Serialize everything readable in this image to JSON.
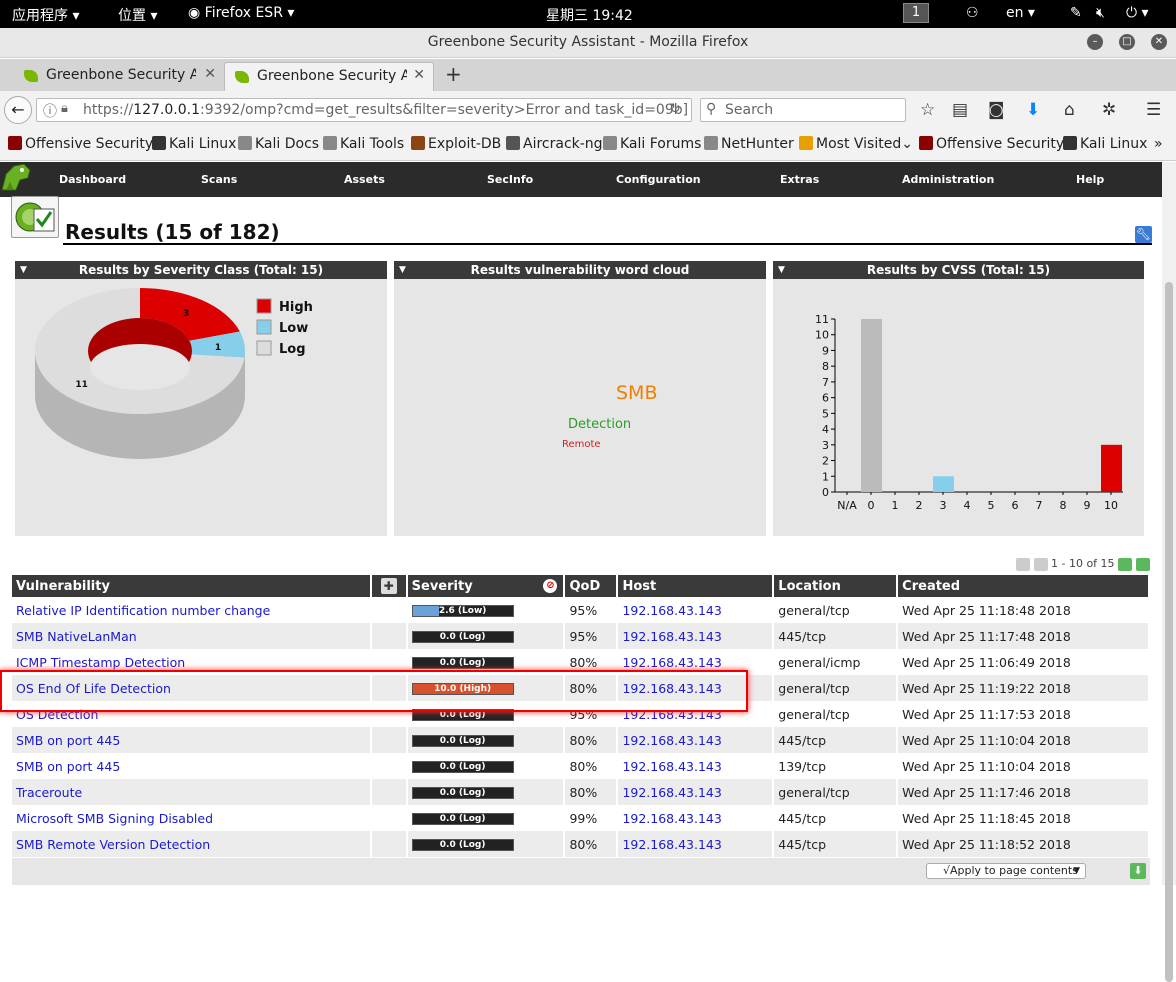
{
  "sysbar": {
    "apps": "应用程序 ▾",
    "places": "位置 ▾",
    "browser": "Firefox ESR ▾",
    "clock": "星期三 19:42",
    "workspace": "1",
    "lang": "en ▾"
  },
  "window": {
    "title": "Greenbone Security Assistant - Mozilla Firefox"
  },
  "tabs": [
    {
      "label": "Greenbone Security A..."
    },
    {
      "label": "Greenbone Security A..."
    }
  ],
  "nav": {
    "url_prefix": "https://",
    "url_host": "127.0.0.1",
    "url_rest": ":9392/omp?cmd=get_results&filter=severity>Error and task_id=09b]",
    "search_placeholder": "Search"
  },
  "bookmarks": [
    {
      "label": "Offensive Security",
      "color": "#8b0000"
    },
    {
      "label": "Kali Linux",
      "color": "#333333"
    },
    {
      "label": "Kali Docs",
      "color": "#888888"
    },
    {
      "label": "Kali Tools",
      "color": "#888888"
    },
    {
      "label": "Exploit-DB",
      "color": "#8b4513"
    },
    {
      "label": "Aircrack-ng",
      "color": "#555555"
    },
    {
      "label": "Kali Forums",
      "color": "#888888"
    },
    {
      "label": "NetHunter",
      "color": "#888888"
    },
    {
      "label": "Most Visited",
      "color": "#e8a000"
    },
    {
      "label": "Offensive Security",
      "color": "#8b0000"
    },
    {
      "label": "Kali Linux",
      "color": "#333333"
    }
  ],
  "appnav": [
    "Dashboard",
    "Scans",
    "Assets",
    "SecInfo",
    "Configuration",
    "Extras",
    "Administration",
    "Help"
  ],
  "page": {
    "title": "Results (15 of 182)"
  },
  "panels": {
    "severity_title": "Results by Severity Class (Total: 15)",
    "cloud_title": "Results vulnerability word cloud",
    "cvss_title": "Results by CVSS (Total: 15)"
  },
  "cloud_words": [
    {
      "text": "SMB",
      "color": "#f08000"
    },
    {
      "text": "Detection",
      "color": "#2a9d2a"
    },
    {
      "text": "Remote",
      "color": "#cc2222"
    }
  ],
  "chart_data": [
    {
      "type": "pie",
      "title": "Results by Severity Class (Total: 15)",
      "categories": [
        "High",
        "Low",
        "Log"
      ],
      "values": [
        3,
        1,
        11
      ],
      "colors": [
        "#dd0000",
        "#87ceeb",
        "#dddddd"
      ],
      "legend": "right"
    },
    {
      "type": "bar",
      "title": "Results by CVSS (Total: 15)",
      "categories": [
        "N/A",
        "0",
        "1",
        "2",
        "3",
        "4",
        "5",
        "6",
        "7",
        "8",
        "9",
        "10"
      ],
      "values": [
        0,
        11,
        0,
        0,
        1,
        0,
        0,
        0,
        0,
        0,
        0,
        3
      ],
      "colors": [
        "#bbbbbb",
        "#bbbbbb",
        "#bbbbbb",
        "#bbbbbb",
        "#87ceeb",
        "#bbbbbb",
        "#bbbbbb",
        "#bbbbbb",
        "#bbbbbb",
        "#bbbbbb",
        "#bbbbbb",
        "#dd0000"
      ],
      "yticks": [
        "0",
        "1",
        "2",
        "3",
        "4",
        "5",
        "6",
        "7",
        "8",
        "9",
        "10",
        "11"
      ],
      "ylim": [
        0,
        11
      ]
    }
  ],
  "pager": {
    "text": "1 - 10 of 15"
  },
  "table": {
    "headers": [
      "Vulnerability",
      "Severity",
      "QoD",
      "Host",
      "Location",
      "Created"
    ],
    "rows": [
      {
        "vuln": "Relative IP Identification number change",
        "sev_label": "2.6 (Low)",
        "sev": 2.6,
        "sev_color": "#6aa3d8",
        "qod": "95%",
        "host": "192.168.43.143",
        "loc": "general/tcp",
        "created": "Wed Apr 25 11:18:48 2018"
      },
      {
        "vuln": "SMB NativeLanMan",
        "sev_label": "0.0 (Log)",
        "sev": 0.0,
        "sev_color": "#222222",
        "qod": "95%",
        "host": "192.168.43.143",
        "loc": "445/tcp",
        "created": "Wed Apr 25 11:17:48 2018"
      },
      {
        "vuln": "ICMP Timestamp Detection",
        "sev_label": "0.0 (Log)",
        "sev": 0.0,
        "sev_color": "#222222",
        "qod": "80%",
        "host": "192.168.43.143",
        "loc": "general/icmp",
        "created": "Wed Apr 25 11:06:49 2018"
      },
      {
        "vuln": "OS End Of Life Detection",
        "sev_label": "10.0 (High)",
        "sev": 10.0,
        "sev_color": "#d9502c",
        "qod": "80%",
        "host": "192.168.43.143",
        "loc": "general/tcp",
        "created": "Wed Apr 25 11:19:22 2018"
      },
      {
        "vuln": "OS Detection",
        "sev_label": "0.0 (Log)",
        "sev": 0.0,
        "sev_color": "#222222",
        "qod": "95%",
        "host": "192.168.43.143",
        "loc": "general/tcp",
        "created": "Wed Apr 25 11:17:53 2018"
      },
      {
        "vuln": "SMB on port 445",
        "sev_label": "0.0 (Log)",
        "sev": 0.0,
        "sev_color": "#222222",
        "qod": "80%",
        "host": "192.168.43.143",
        "loc": "445/tcp",
        "created": "Wed Apr 25 11:10:04 2018"
      },
      {
        "vuln": "SMB on port 445",
        "sev_label": "0.0 (Log)",
        "sev": 0.0,
        "sev_color": "#222222",
        "qod": "80%",
        "host": "192.168.43.143",
        "loc": "139/tcp",
        "created": "Wed Apr 25 11:10:04 2018"
      },
      {
        "vuln": "Traceroute",
        "sev_label": "0.0 (Log)",
        "sev": 0.0,
        "sev_color": "#222222",
        "qod": "80%",
        "host": "192.168.43.143",
        "loc": "general/tcp",
        "created": "Wed Apr 25 11:17:46 2018"
      },
      {
        "vuln": "Microsoft SMB Signing Disabled",
        "sev_label": "0.0 (Log)",
        "sev": 0.0,
        "sev_color": "#222222",
        "qod": "99%",
        "host": "192.168.43.143",
        "loc": "445/tcp",
        "created": "Wed Apr 25 11:18:45 2018"
      },
      {
        "vuln": "SMB Remote Version Detection",
        "sev_label": "0.0 (Log)",
        "sev": 0.0,
        "sev_color": "#222222",
        "qod": "80%",
        "host": "192.168.43.143",
        "loc": "445/tcp",
        "created": "Wed Apr 25 11:18:52 2018"
      }
    ]
  },
  "footer": {
    "apply_label": "√Apply to page contents"
  }
}
